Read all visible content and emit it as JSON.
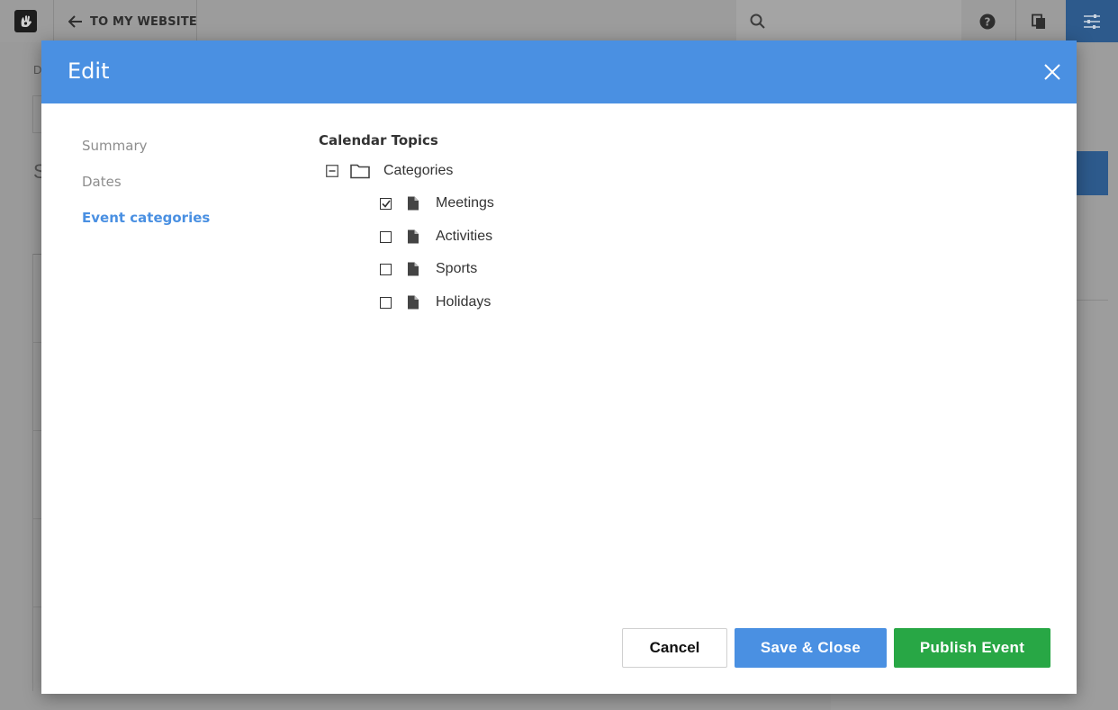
{
  "topbar": {
    "back_label": "TO MY WEBSITE"
  },
  "background": {
    "letter_d": "D",
    "letter_s": "S"
  },
  "modal": {
    "title": "Edit",
    "nav": [
      {
        "label": "Summary",
        "active": false
      },
      {
        "label": "Dates",
        "active": false
      },
      {
        "label": "Event categories",
        "active": true
      }
    ],
    "tree": {
      "title": "Calendar Topics",
      "root": {
        "label": "Categories",
        "expanded": true
      },
      "items": [
        {
          "label": "Meetings",
          "checked": true
        },
        {
          "label": "Activities",
          "checked": false
        },
        {
          "label": "Sports",
          "checked": false
        },
        {
          "label": "Holidays",
          "checked": false
        }
      ]
    },
    "buttons": {
      "cancel": "Cancel",
      "save_close": "Save & Close",
      "publish": "Publish Event"
    }
  },
  "colors": {
    "accent": "#4a90e2",
    "publish": "#28a745",
    "active_nav": "#4a90e2",
    "toolbar_active": "#2d5a8c"
  },
  "icons": [
    "concrete-logo-icon",
    "arrow-left-icon",
    "search-icon",
    "help-icon",
    "pages-icon",
    "sliders-icon",
    "close-icon",
    "collapse-minus-icon",
    "folder-icon",
    "file-icon",
    "checkbox-icon"
  ]
}
